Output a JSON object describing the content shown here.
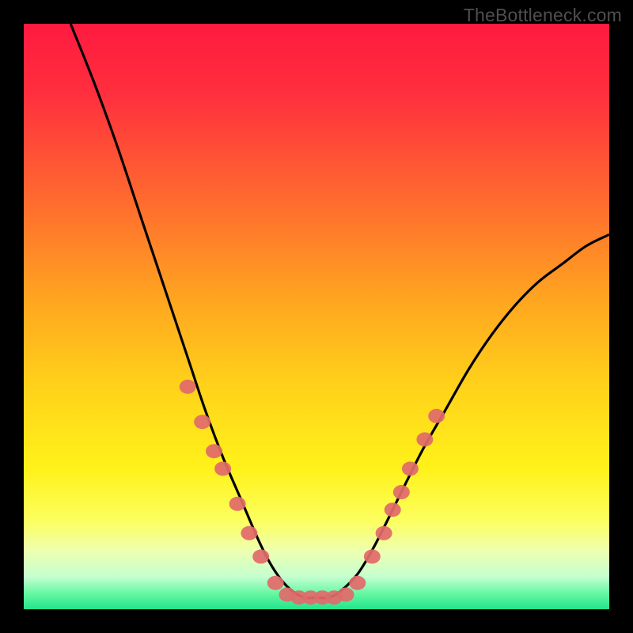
{
  "watermark": "TheBottleneck.com",
  "chart_data": {
    "type": "line",
    "title": "",
    "xlabel": "",
    "ylabel": "",
    "xlim": [
      0,
      100
    ],
    "ylim": [
      0,
      100
    ],
    "grid": false,
    "legend": false,
    "gradient_stops": [
      {
        "offset": 0.0,
        "color": "#ff1a3f"
      },
      {
        "offset": 0.12,
        "color": "#ff2f3e"
      },
      {
        "offset": 0.3,
        "color": "#ff6a2f"
      },
      {
        "offset": 0.48,
        "color": "#ffa81f"
      },
      {
        "offset": 0.62,
        "color": "#ffd21a"
      },
      {
        "offset": 0.76,
        "color": "#fff21a"
      },
      {
        "offset": 0.85,
        "color": "#fcff60"
      },
      {
        "offset": 0.9,
        "color": "#eeffb0"
      },
      {
        "offset": 0.945,
        "color": "#c4ffd0"
      },
      {
        "offset": 0.975,
        "color": "#60f7a0"
      },
      {
        "offset": 1.0,
        "color": "#22e58b"
      }
    ],
    "series": [
      {
        "name": "bottleneck-curve",
        "color": "#000000",
        "x": [
          8,
          12,
          16,
          20,
          24,
          28,
          31,
          34,
          37,
          40,
          42,
          44,
          46,
          48,
          50,
          52,
          54,
          57,
          60,
          64,
          68,
          72,
          76,
          80,
          84,
          88,
          92,
          96,
          100
        ],
        "y": [
          100,
          90,
          79,
          67,
          55,
          43,
          34,
          26,
          19,
          12,
          8,
          5,
          3,
          2,
          2,
          2,
          3,
          6,
          11,
          19,
          27,
          34,
          41,
          47,
          52,
          56,
          59,
          62,
          64
        ]
      }
    ],
    "markers": {
      "name": "highlight-dots",
      "color": "#e16a6a",
      "points": [
        {
          "x": 28.0,
          "y": 38
        },
        {
          "x": 30.5,
          "y": 32
        },
        {
          "x": 32.5,
          "y": 27
        },
        {
          "x": 34.0,
          "y": 24
        },
        {
          "x": 36.5,
          "y": 18
        },
        {
          "x": 38.5,
          "y": 13
        },
        {
          "x": 40.5,
          "y": 9
        },
        {
          "x": 43.0,
          "y": 4.5
        },
        {
          "x": 45.0,
          "y": 2.5
        },
        {
          "x": 47.0,
          "y": 2.0
        },
        {
          "x": 49.0,
          "y": 2.0
        },
        {
          "x": 51.0,
          "y": 2.0
        },
        {
          "x": 53.0,
          "y": 2.0
        },
        {
          "x": 55.0,
          "y": 2.5
        },
        {
          "x": 57.0,
          "y": 4.5
        },
        {
          "x": 59.5,
          "y": 9
        },
        {
          "x": 61.5,
          "y": 13
        },
        {
          "x": 63.0,
          "y": 17
        },
        {
          "x": 64.5,
          "y": 20
        },
        {
          "x": 66.0,
          "y": 24
        },
        {
          "x": 68.5,
          "y": 29
        },
        {
          "x": 70.5,
          "y": 33
        }
      ]
    }
  }
}
